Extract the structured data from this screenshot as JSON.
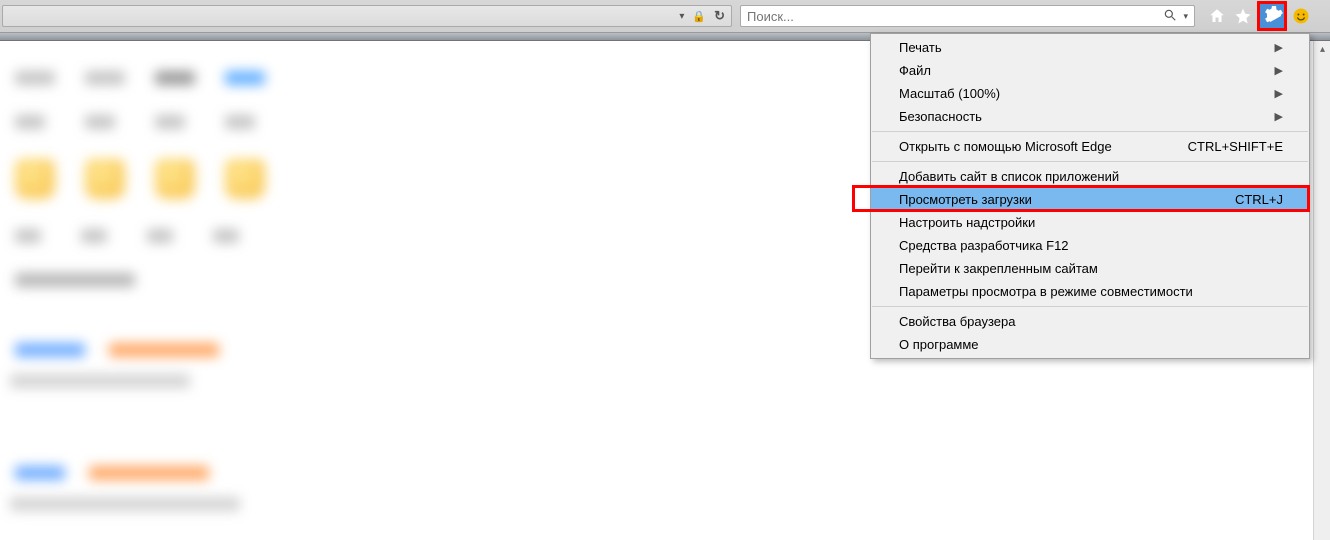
{
  "chrome": {
    "search_placeholder": "Поиск...",
    "icons": {
      "dropdown": "dropdown",
      "lock": "lock",
      "refresh": "refresh",
      "magnifier": "search",
      "home": "home",
      "star": "favorites",
      "gear": "tools",
      "smiley": "feedback"
    }
  },
  "menu": {
    "groups": [
      [
        {
          "label": "Печать",
          "submenu": true
        },
        {
          "label": "Файл",
          "submenu": true
        },
        {
          "label": "Масштаб (100%)",
          "submenu": true
        },
        {
          "label": "Безопасность",
          "submenu": true
        }
      ],
      [
        {
          "label": "Открыть с помощью Microsoft Edge",
          "shortcut": "CTRL+SHIFT+E"
        }
      ],
      [
        {
          "label": "Добавить сайт в список приложений"
        },
        {
          "label": "Просмотреть загрузки",
          "shortcut": "CTRL+J",
          "highlight": true
        },
        {
          "label": "Настроить надстройки"
        },
        {
          "label": "Средства разработчика F12"
        },
        {
          "label": "Перейти к закрепленным сайтам"
        },
        {
          "label": "Параметры просмотра в режиме совместимости"
        }
      ],
      [
        {
          "label": "Свойства браузера"
        },
        {
          "label": "О программе"
        }
      ]
    ]
  }
}
